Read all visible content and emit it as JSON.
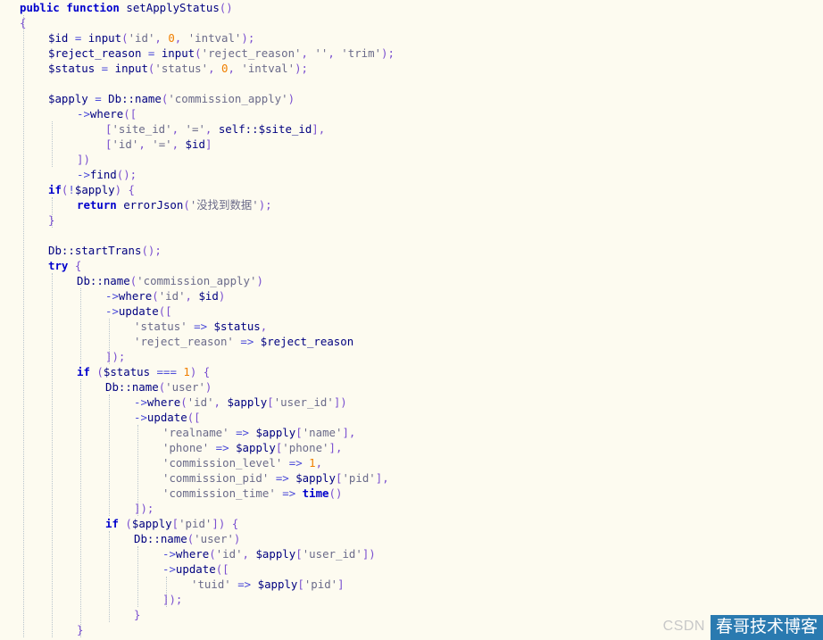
{
  "code_lines": [
    [
      [
        "kw",
        "public "
      ],
      [
        "kw",
        "function "
      ],
      [
        "plain",
        "setApplyStatus"
      ],
      [
        "pn",
        "()"
      ]
    ],
    [
      [
        "pn",
        "{"
      ]
    ],
    [
      [
        "var",
        "$id"
      ],
      [
        "op",
        " = "
      ],
      [
        "plain",
        "input"
      ],
      [
        "pn",
        "("
      ],
      [
        "str",
        "'id'"
      ],
      [
        "pn",
        ", "
      ],
      [
        "num",
        "0"
      ],
      [
        "pn",
        ", "
      ],
      [
        "str",
        "'intval'"
      ],
      [
        "pn",
        ");"
      ]
    ],
    [
      [
        "var",
        "$reject_reason"
      ],
      [
        "op",
        " = "
      ],
      [
        "plain",
        "input"
      ],
      [
        "pn",
        "("
      ],
      [
        "str",
        "'reject_reason'"
      ],
      [
        "pn",
        ", "
      ],
      [
        "str",
        "''"
      ],
      [
        "pn",
        ", "
      ],
      [
        "str",
        "'trim'"
      ],
      [
        "pn",
        ");"
      ]
    ],
    [
      [
        "var",
        "$status"
      ],
      [
        "op",
        " = "
      ],
      [
        "plain",
        "input"
      ],
      [
        "pn",
        "("
      ],
      [
        "str",
        "'status'"
      ],
      [
        "pn",
        ", "
      ],
      [
        "num",
        "0"
      ],
      [
        "pn",
        ", "
      ],
      [
        "str",
        "'intval'"
      ],
      [
        "pn",
        ");"
      ]
    ],
    [],
    [
      [
        "var",
        "$apply"
      ],
      [
        "op",
        " = "
      ],
      [
        "plain",
        "Db::name"
      ],
      [
        "pn",
        "("
      ],
      [
        "str",
        "'commission_apply'"
      ],
      [
        "pn",
        ")"
      ]
    ],
    [
      [
        "op",
        "->"
      ],
      [
        "plain",
        "where"
      ],
      [
        "pn",
        "(["
      ]
    ],
    [
      [
        "pn",
        "["
      ],
      [
        "str",
        "'site_id'"
      ],
      [
        "pn",
        ", "
      ],
      [
        "str",
        "'='"
      ],
      [
        "pn",
        ", "
      ],
      [
        "plain",
        "self::"
      ],
      [
        "var",
        "$site_id"
      ],
      [
        "pn",
        "],"
      ]
    ],
    [
      [
        "pn",
        "["
      ],
      [
        "str",
        "'id'"
      ],
      [
        "pn",
        ", "
      ],
      [
        "str",
        "'='"
      ],
      [
        "pn",
        ", "
      ],
      [
        "var",
        "$id"
      ],
      [
        "pn",
        "]"
      ]
    ],
    [
      [
        "pn",
        "])"
      ]
    ],
    [
      [
        "op",
        "->"
      ],
      [
        "plain",
        "find"
      ],
      [
        "pn",
        "();"
      ]
    ],
    [
      [
        "kw",
        "if"
      ],
      [
        "pn",
        "("
      ],
      [
        "op",
        "!"
      ],
      [
        "var",
        "$apply"
      ],
      [
        "pn",
        ") {"
      ]
    ],
    [
      [
        "kw",
        "return "
      ],
      [
        "plain",
        "errorJson"
      ],
      [
        "pn",
        "("
      ],
      [
        "str",
        "'没找到数据'"
      ],
      [
        "pn",
        ");"
      ]
    ],
    [
      [
        "pn",
        "}"
      ]
    ],
    [],
    [
      [
        "plain",
        "Db::startTrans"
      ],
      [
        "pn",
        "();"
      ]
    ],
    [
      [
        "kw",
        "try "
      ],
      [
        "pn",
        "{"
      ]
    ],
    [
      [
        "plain",
        "Db::name"
      ],
      [
        "pn",
        "("
      ],
      [
        "str",
        "'commission_apply'"
      ],
      [
        "pn",
        ")"
      ]
    ],
    [
      [
        "op",
        "->"
      ],
      [
        "plain",
        "where"
      ],
      [
        "pn",
        "("
      ],
      [
        "str",
        "'id'"
      ],
      [
        "pn",
        ", "
      ],
      [
        "var",
        "$id"
      ],
      [
        "pn",
        ")"
      ]
    ],
    [
      [
        "op",
        "->"
      ],
      [
        "plain",
        "update"
      ],
      [
        "pn",
        "(["
      ]
    ],
    [
      [
        "str",
        "'status'"
      ],
      [
        "op",
        " => "
      ],
      [
        "var",
        "$status"
      ],
      [
        "pn",
        ","
      ]
    ],
    [
      [
        "str",
        "'reject_reason'"
      ],
      [
        "op",
        " => "
      ],
      [
        "var",
        "$reject_reason"
      ]
    ],
    [
      [
        "pn",
        "]);"
      ]
    ],
    [
      [
        "kw",
        "if "
      ],
      [
        "pn",
        "("
      ],
      [
        "var",
        "$status"
      ],
      [
        "op",
        " === "
      ],
      [
        "num",
        "1"
      ],
      [
        "pn",
        ") {"
      ]
    ],
    [
      [
        "plain",
        "Db::name"
      ],
      [
        "pn",
        "("
      ],
      [
        "str",
        "'user'"
      ],
      [
        "pn",
        ")"
      ]
    ],
    [
      [
        "op",
        "->"
      ],
      [
        "plain",
        "where"
      ],
      [
        "pn",
        "("
      ],
      [
        "str",
        "'id'"
      ],
      [
        "pn",
        ", "
      ],
      [
        "var",
        "$apply"
      ],
      [
        "pn",
        "["
      ],
      [
        "str",
        "'user_id'"
      ],
      [
        "pn",
        "])"
      ]
    ],
    [
      [
        "op",
        "->"
      ],
      [
        "plain",
        "update"
      ],
      [
        "pn",
        "(["
      ]
    ],
    [
      [
        "str",
        "'realname'"
      ],
      [
        "op",
        " => "
      ],
      [
        "var",
        "$apply"
      ],
      [
        "pn",
        "["
      ],
      [
        "str",
        "'name'"
      ],
      [
        "pn",
        "],"
      ]
    ],
    [
      [
        "str",
        "'phone'"
      ],
      [
        "op",
        " => "
      ],
      [
        "var",
        "$apply"
      ],
      [
        "pn",
        "["
      ],
      [
        "str",
        "'phone'"
      ],
      [
        "pn",
        "],"
      ]
    ],
    [
      [
        "str",
        "'commission_level'"
      ],
      [
        "op",
        " => "
      ],
      [
        "num",
        "1"
      ],
      [
        "pn",
        ","
      ]
    ],
    [
      [
        "str",
        "'commission_pid'"
      ],
      [
        "op",
        " => "
      ],
      [
        "var",
        "$apply"
      ],
      [
        "pn",
        "["
      ],
      [
        "str",
        "'pid'"
      ],
      [
        "pn",
        "],"
      ]
    ],
    [
      [
        "str",
        "'commission_time'"
      ],
      [
        "op",
        " => "
      ],
      [
        "kw",
        "time"
      ],
      [
        "pn",
        "()"
      ]
    ],
    [
      [
        "pn",
        "]);"
      ]
    ],
    [
      [
        "kw",
        "if "
      ],
      [
        "pn",
        "("
      ],
      [
        "var",
        "$apply"
      ],
      [
        "pn",
        "["
      ],
      [
        "str",
        "'pid'"
      ],
      [
        "pn",
        "]) {"
      ]
    ],
    [
      [
        "plain",
        "Db::name"
      ],
      [
        "pn",
        "("
      ],
      [
        "str",
        "'user'"
      ],
      [
        "pn",
        ")"
      ]
    ],
    [
      [
        "op",
        "->"
      ],
      [
        "plain",
        "where"
      ],
      [
        "pn",
        "("
      ],
      [
        "str",
        "'id'"
      ],
      [
        "pn",
        ", "
      ],
      [
        "var",
        "$apply"
      ],
      [
        "pn",
        "["
      ],
      [
        "str",
        "'user_id'"
      ],
      [
        "pn",
        "])"
      ]
    ],
    [
      [
        "op",
        "->"
      ],
      [
        "plain",
        "update"
      ],
      [
        "pn",
        "(["
      ]
    ],
    [
      [
        "str",
        "'tuid'"
      ],
      [
        "op",
        " => "
      ],
      [
        "var",
        "$apply"
      ],
      [
        "pn",
        "["
      ],
      [
        "str",
        "'pid'"
      ],
      [
        "pn",
        "]"
      ]
    ],
    [
      [
        "pn",
        "]);"
      ]
    ],
    [
      [
        "pn",
        "}"
      ]
    ],
    [
      [
        "pn",
        "}"
      ]
    ]
  ],
  "watermark": {
    "csdn": "CSDN",
    "blog": "春哥技术博客"
  }
}
